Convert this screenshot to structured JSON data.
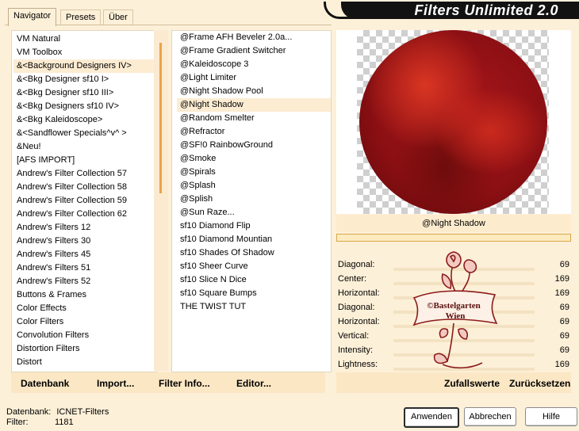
{
  "tabs": [
    {
      "label": "Navigator"
    },
    {
      "label": "Presets"
    },
    {
      "label": "Über"
    }
  ],
  "title": "Filters Unlimited 2.0",
  "categories": [
    "VM Natural",
    "VM Toolbox",
    "&<Background Designers IV>",
    "&<Bkg Designer sf10 I>",
    "&<Bkg Designer sf10 III>",
    "&<Bkg Designers sf10 IV>",
    "&<Bkg Kaleidoscope>",
    "&<Sandflower Specials^v^ >",
    "&Neu!",
    "[AFS IMPORT]",
    "Andrew's Filter Collection 57",
    "Andrew's Filter Collection 58",
    "Andrew's Filter Collection 59",
    "Andrew's Filter Collection 62",
    "Andrew's Filters 12",
    "Andrew's Filters 30",
    "Andrew's Filters 45",
    "Andrew's Filters 51",
    "Andrew's Filters 52",
    "Buttons & Frames",
    "Color Effects",
    "Color Filters",
    "Convolution Filters",
    "Distortion Filters",
    "Distort"
  ],
  "categories_selected": 2,
  "filters": [
    "@Frame AFH Beveler 2.0a...",
    "@Frame Gradient Switcher",
    "@Kaleidoscope 3",
    "@Light Limiter",
    "@Night Shadow Pool",
    "@Night Shadow",
    "@Random Smelter",
    "@Refractor",
    "@SF!0 RainbowGround",
    "@Smoke",
    "@Spirals",
    "@Splash",
    "@Splish",
    "@Sun Raze...",
    "sf10 Diamond Flip",
    "sf10 Diamond Mountian",
    "sf10 Shades Of Shadow",
    "sf10 Sheer Curve",
    "sf10 Slice N Dice",
    "sf10 Square Bumps",
    "THE TWIST TUT"
  ],
  "filters_selected": 5,
  "list_buttons": {
    "datenbank": "Datenbank",
    "import": "Import...",
    "filter_info": "Filter Info...",
    "editor": "Editor..."
  },
  "preview": {
    "filter_name": "@Night Shadow"
  },
  "parameters": [
    {
      "label": "Diagonal:",
      "value": "69"
    },
    {
      "label": "Center:",
      "value": "169"
    },
    {
      "label": "Horizontal:",
      "value": "169"
    },
    {
      "label": "Diagonal:",
      "value": "69"
    },
    {
      "label": "Horizontal:",
      "value": "69"
    },
    {
      "label": "Vertical:",
      "value": "69"
    },
    {
      "label": "Intensity:",
      "value": "69"
    },
    {
      "label": "Lightness:",
      "value": "169"
    }
  ],
  "logo_text": [
    "©Bastelgarten",
    "Wien"
  ],
  "param_buttons": {
    "random": "Zufallswerte",
    "reset": "Zurücksetzen"
  },
  "status": {
    "db_label": "Datenbank:",
    "db_value": "ICNET-Filters",
    "filter_label": "Filter:",
    "filter_value": "1181"
  },
  "dialog_buttons": {
    "apply": "Anwenden",
    "cancel": "Abbrechen",
    "help": "Hilfe"
  },
  "colors": {
    "background": "#fdf0d8",
    "accent": "#e8a44a",
    "title_bar": "#121212"
  }
}
